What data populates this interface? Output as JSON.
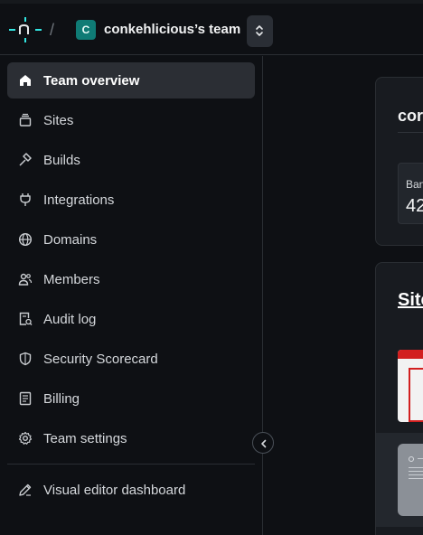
{
  "header": {
    "team_initial": "C",
    "team_name": "conkehlicious’s team",
    "separator": "/"
  },
  "sidebar": {
    "items": [
      {
        "label": "Team overview",
        "icon": "home-icon",
        "active": true
      },
      {
        "label": "Sites",
        "icon": "sites-stack-icon",
        "active": false
      },
      {
        "label": "Builds",
        "icon": "hammer-icon",
        "active": false
      },
      {
        "label": "Integrations",
        "icon": "plug-icon",
        "active": false
      },
      {
        "label": "Domains",
        "icon": "globe-icon",
        "active": false
      },
      {
        "label": "Members",
        "icon": "members-icon",
        "active": false
      },
      {
        "label": "Audit log",
        "icon": "audit-log-icon",
        "active": false
      },
      {
        "label": "Security Scorecard",
        "icon": "shield-icon",
        "active": false
      },
      {
        "label": "Billing",
        "icon": "billing-icon",
        "active": false
      },
      {
        "label": "Team settings",
        "icon": "gear-icon",
        "active": false
      }
    ],
    "footer_item": {
      "label": "Visual editor dashboard",
      "icon": "pencil-icon"
    }
  },
  "main": {
    "card1_title": "cor",
    "stat_label": "Ban",
    "stat_value": "42",
    "card2_title": "Site"
  },
  "colors": {
    "background": "#0e1014",
    "active_item": "#2b2e34",
    "team_avatar": "#0f7b75",
    "logo": "#32e6e2"
  }
}
